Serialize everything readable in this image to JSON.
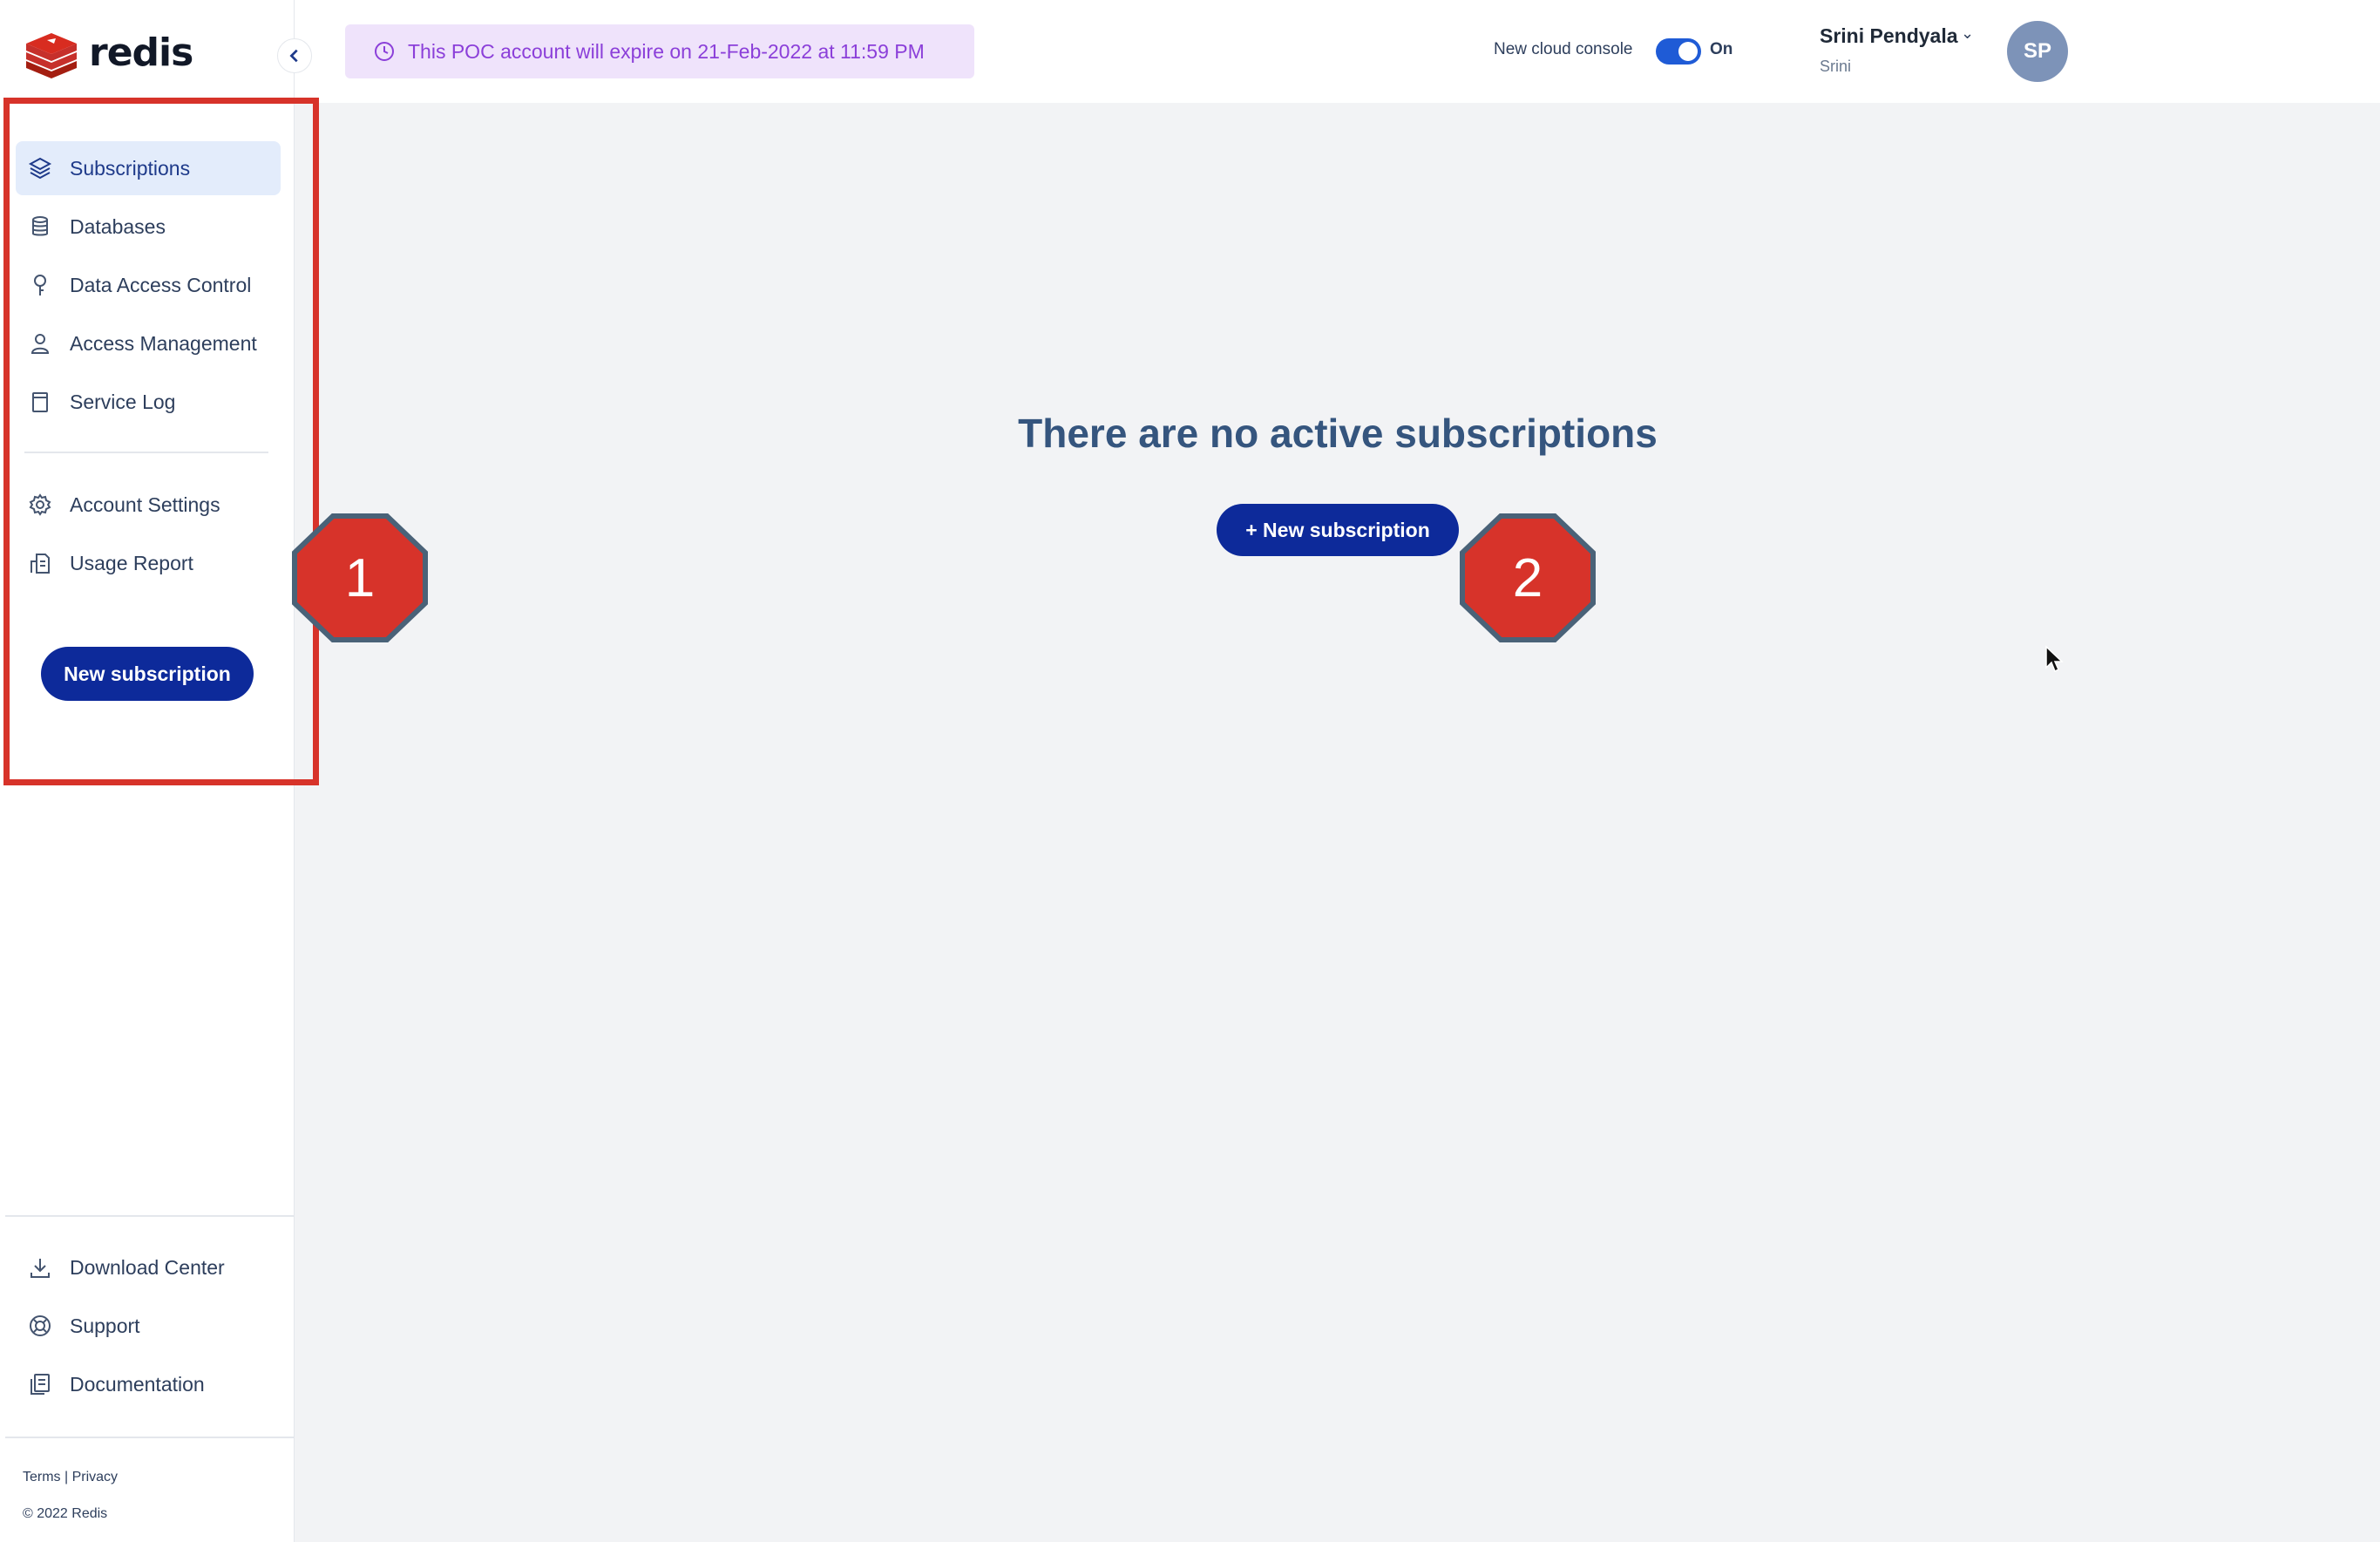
{
  "brand": {
    "name": "redis"
  },
  "collapse_icon": "chevron-left-icon",
  "sidebar": {
    "primary": [
      {
        "label": "Subscriptions",
        "icon": "layers-icon",
        "active": true
      },
      {
        "label": "Databases",
        "icon": "database-icon",
        "active": false
      },
      {
        "label": "Data Access Control",
        "icon": "key-icon",
        "active": false
      },
      {
        "label": "Access Management",
        "icon": "user-icon",
        "active": false
      },
      {
        "label": "Service Log",
        "icon": "log-icon",
        "active": false
      }
    ],
    "secondary": [
      {
        "label": "Account Settings",
        "icon": "gear-icon"
      },
      {
        "label": "Usage Report",
        "icon": "report-icon"
      }
    ],
    "new_subscription_label": "New subscription",
    "bottom": [
      {
        "label": "Download Center",
        "icon": "download-icon"
      },
      {
        "label": "Support",
        "icon": "lifebuoy-icon"
      },
      {
        "label": "Documentation",
        "icon": "document-icon"
      }
    ],
    "footer_links": "Terms | Privacy",
    "copyright": "© 2022 Redis"
  },
  "header": {
    "poc_banner": "This POC account will expire on 21-Feb-2022 at 11:59 PM",
    "console_label": "New cloud console",
    "toggle_state": "On",
    "user_name": "Srini Pendyala",
    "user_org": "Srini",
    "avatar_initials": "SP"
  },
  "main": {
    "empty_title": "There are no active subscriptions",
    "new_subscription_button": "+ New subscription"
  },
  "annotations": {
    "badge_1": "1",
    "badge_2": "2",
    "color": "#d7332a"
  }
}
